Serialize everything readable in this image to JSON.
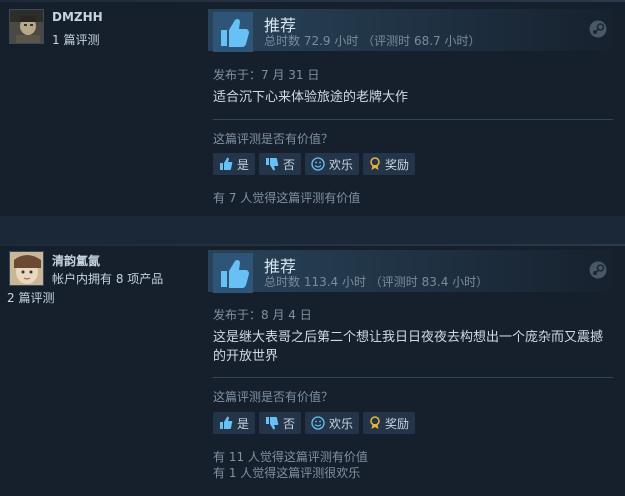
{
  "reviews": [
    {
      "username": "DMZHH",
      "products_owned": "",
      "review_count": "1 篇评测",
      "verdict": "推荐",
      "hours": "总时数 72.9 小时 （评测时 68.7 小时）",
      "posted": "发布于：7 月 31 日",
      "text": "适合沉下心来体验旅途的老牌大作",
      "helpful_question": "这篇评测是否有价值？",
      "buttons": {
        "yes": "是",
        "no": "否",
        "funny": "欢乐",
        "award": "奖励"
      },
      "stats": [
        "有 7 人觉得这篇评测有价值"
      ]
    },
    {
      "username": "清韵氲氤",
      "products_owned": "帐户内拥有 8 项产品",
      "review_count": "2 篇评测",
      "verdict": "推荐",
      "hours": "总时数 113.4 小时 （评测时 83.4 小时）",
      "posted": "发布于：8 月 4 日",
      "text": "这是继大表哥之后第二个想让我日日夜夜去构想出一个庞杂而又震撼的开放世界",
      "helpful_question": "这篇评测是否有价值？",
      "buttons": {
        "yes": "是",
        "no": "否",
        "funny": "欢乐",
        "award": "奖励"
      },
      "stats": [
        "有 11 人觉得这篇评测有价值",
        "有 1 人觉得这篇评测很欢乐"
      ]
    }
  ],
  "colors": {
    "background": "#1b2838",
    "panel": "#16202d",
    "accent": "#66c0f4",
    "award": "#e8b23b"
  },
  "icons": [
    "thumbs-up-icon",
    "steam-icon",
    "thumb-up-small-icon",
    "thumb-down-small-icon",
    "smiley-icon",
    "award-icon"
  ]
}
